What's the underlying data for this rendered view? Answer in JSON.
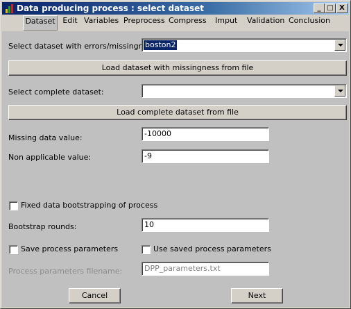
{
  "window": {
    "title": "Data producing process : select dataset",
    "controls": [
      "_",
      "□",
      "X"
    ]
  },
  "tabs": [
    {
      "label": "Dataset",
      "active": true
    },
    {
      "label": "Edit"
    },
    {
      "label": "Variables"
    },
    {
      "label": "Preprocess"
    },
    {
      "label": "Compress"
    },
    {
      "label": "Imput"
    },
    {
      "label": "Validation"
    },
    {
      "label": "Conclusion"
    }
  ],
  "dataset": {
    "errors_label": "Select dataset with errors/missingness:",
    "errors_value": "boston2",
    "load_errors_button": "Load dataset with missingness from file",
    "complete_label": "Select complete dataset:",
    "complete_value": "",
    "load_complete_button": "Load complete dataset from file"
  },
  "values": {
    "missing_label": "Missing data value:",
    "missing_value": "-10000",
    "nonapplicable_label": "Non applicable value:",
    "nonapplicable_value": "-9"
  },
  "bootstrap": {
    "fixed_label": "Fixed data bootstrapping of process",
    "fixed_checked": false,
    "rounds_label": "Bootstrap rounds:",
    "rounds_value": "10"
  },
  "params": {
    "save_label": "Save process parameters",
    "save_checked": false,
    "use_label": "Use saved process parameters",
    "use_checked": false,
    "filename_label": "Process parameters filename:",
    "filename_value": "DPP_parameters.txt"
  },
  "footer": {
    "cancel_label": "Cancel",
    "next_label": "Next"
  }
}
